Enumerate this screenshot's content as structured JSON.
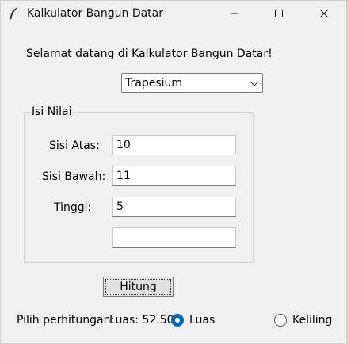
{
  "window": {
    "title": "Kalkulator Bangun Datar",
    "icon": "feather-icon",
    "controls": [
      "minimize-icon",
      "maximize-icon",
      "close-icon"
    ]
  },
  "welcome": "Selamat datang di Kalkulator Bangun Datar!",
  "shape_select": {
    "selected": "Trapesium"
  },
  "group": {
    "label": "Isi Nilai",
    "fields": [
      {
        "label": "Sisi Atas:",
        "value": "10"
      },
      {
        "label": "Sisi Bawah:",
        "value": "11"
      },
      {
        "label": "Tinggi:",
        "value": "5"
      },
      {
        "label": "",
        "value": ""
      }
    ]
  },
  "button": {
    "label": "Hitung"
  },
  "calc": {
    "label": "Pilih perhitungan:",
    "result": "Luas: 52.50",
    "options": [
      {
        "label": "Luas",
        "selected": true
      },
      {
        "label": "Keliling",
        "selected": false
      }
    ],
    "accent": "#0067c0"
  }
}
